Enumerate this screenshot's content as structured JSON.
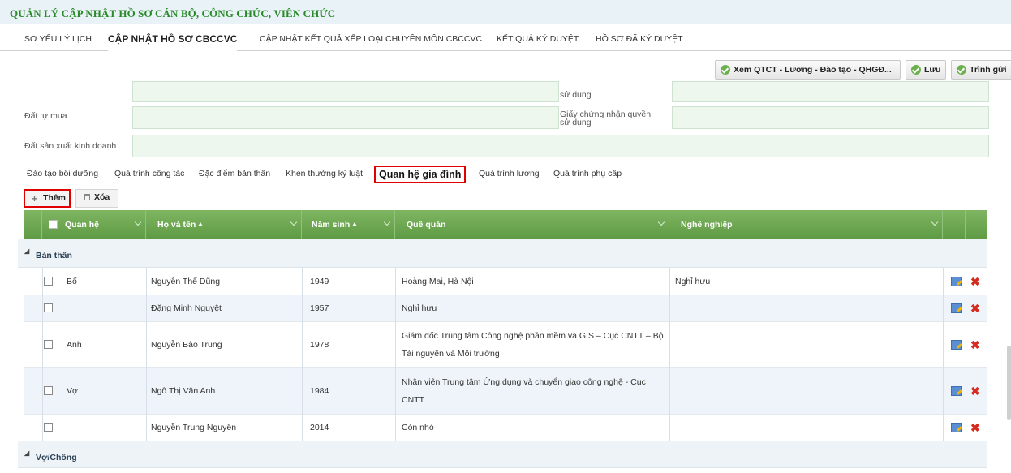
{
  "page_title": "QUẢN LÝ CẬP NHẬT HỒ SƠ CÁN BỘ, CÔNG CHỨC, VIÊN CHỨC",
  "main_tabs": [
    {
      "label": "SƠ YẾU LÝ LỊCH",
      "active": false
    },
    {
      "label": "CẬP NHẬT HỒ SƠ CBCCVC",
      "active": true
    },
    {
      "label": "CẬP NHẬT KẾT QUẢ XẾP LOẠI CHUYÊN MÔN CBCCVC",
      "active": false
    },
    {
      "label": "KẾT QUẢ KÝ DUYỆT",
      "active": false
    },
    {
      "label": "HỒ SƠ ĐÃ KÝ DUYỆT",
      "active": false
    }
  ],
  "toolbar": {
    "view_label": "Xem QTCT - Lương - Đào tạo - QHGĐ...",
    "save_label": "Lưu",
    "submit_label": "Trình gửi"
  },
  "form": {
    "partial_label_right": "sử dụng",
    "land_bought_label": "Đất tự mua",
    "certificate_label_line1": "Giấy chứng nhận quyền",
    "certificate_label_line2": "sử dụng",
    "land_business_label": "Đất sản xuất kinh doanh"
  },
  "sub_tabs": [
    {
      "label": "Đào tạo bồi dưỡng",
      "active": false
    },
    {
      "label": "Quá trình công tác",
      "active": false
    },
    {
      "label": "Đặc điểm bản thân",
      "active": false
    },
    {
      "label": "Khen thưởng kỷ luật",
      "active": false
    },
    {
      "label": "Quan hệ gia đình",
      "active": true
    },
    {
      "label": "Quá trình lương",
      "active": false
    },
    {
      "label": "Quá trình phụ cấp",
      "active": false
    }
  ],
  "grid_actions": {
    "add_label": "Thêm",
    "delete_label": "Xóa"
  },
  "grid": {
    "columns": [
      "Quan hệ",
      "Họ và tên",
      "Năm sinh",
      "Quê quán",
      "Nghề nghiệp"
    ],
    "groups": [
      {
        "label": "Bản thân",
        "rows": [
          {
            "relation": "Bố",
            "name": "Nguyễn Thế Dũng",
            "birth_year": "1949",
            "hometown_line1": "Hoàng Mai, Hà Nội",
            "hometown_line2": "",
            "occupation": "Nghỉ hưu"
          },
          {
            "relation": "",
            "name": "Đặng Minh Nguyệt",
            "birth_year": "1957",
            "hometown_line1": "Nghỉ hưu",
            "hometown_line2": "",
            "occupation": ""
          },
          {
            "relation": "Anh",
            "name": "Nguyễn Bảo Trung",
            "birth_year": "1978",
            "hometown_line1": "Giám đốc Trung tâm Công nghệ phần mềm và GIS – Cục CNTT – Bộ",
            "hometown_line2": "Tài nguyên và Môi trường",
            "occupation": ""
          },
          {
            "relation": "Vợ",
            "name": "Ngô Thị Vân Anh",
            "birth_year": "1984",
            "hometown_line1": "Nhân viên Trung tâm Ứng dụng và chuyển giao công nghệ - Cục",
            "hometown_line2": "CNTT",
            "occupation": ""
          },
          {
            "relation": "",
            "name": "Nguyễn Trung Nguyên",
            "birth_year": "2014",
            "hometown_line1": "Còn nhỏ",
            "hometown_line2": "",
            "occupation": ""
          }
        ]
      },
      {
        "label": "Vợ/Chồng",
        "rows": []
      }
    ]
  },
  "colors": {
    "title_green": "#2a8a2a",
    "header_green": "#6aa84f",
    "highlight_red": "#e00000",
    "field_bg": "#eef7ee"
  }
}
